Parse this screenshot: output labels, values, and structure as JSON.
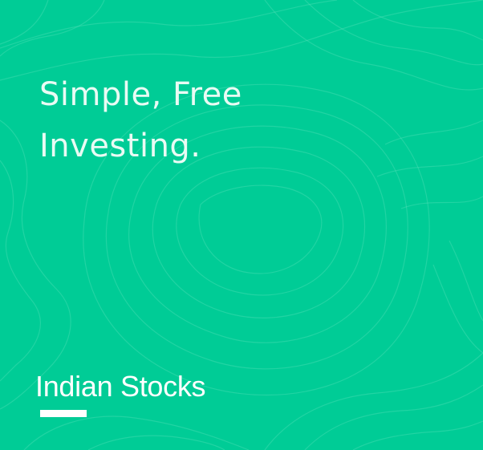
{
  "banner": {
    "headline_line1": "Simple, Free",
    "headline_line2": "Investing.",
    "category_label": "Indian Stocks"
  },
  "colors": {
    "background": "#00cc96",
    "headline_text": "#e9fbf4",
    "category_text": "#ffffff",
    "contour_lines": "#5fe3bd"
  },
  "decorations": {
    "background_pattern": "topographic-contour-lines",
    "underline": "white-bar"
  }
}
